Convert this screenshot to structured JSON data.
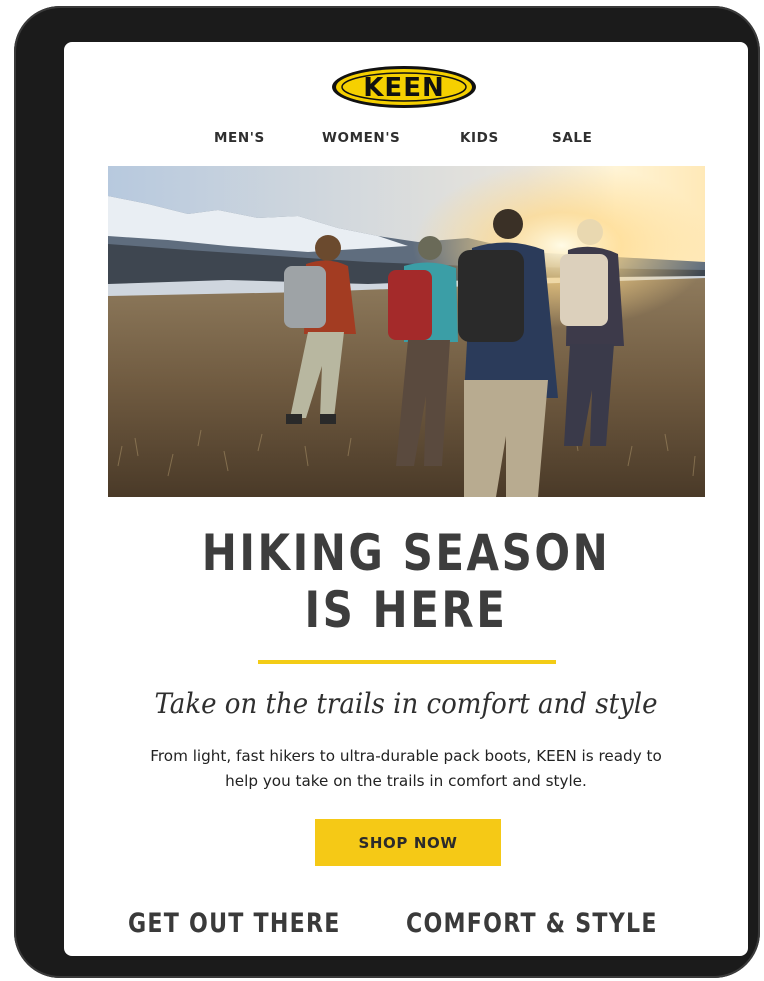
{
  "brand": {
    "logo_text": "KEEN",
    "logo_color": "#f5d000",
    "logo_outline": "#111111"
  },
  "nav": {
    "items": [
      "MEN'S",
      "WOMEN'S",
      "KIDS",
      "SALE"
    ]
  },
  "hero": {
    "image": "group-of-hikers-walking-across-meadow-at-sunset"
  },
  "headline": {
    "line1": "HIKING SEASON",
    "line2": "IS HERE"
  },
  "subhead": "Take on the trails in comfort and style",
  "body": {
    "line1": "From light, fast hikers to ultra-durable pack boots, KEEN is ready to",
    "line2": "help you take on the trails in comfort and style."
  },
  "cta": {
    "label": "SHOP NOW",
    "color": "#f5c916"
  },
  "sections": {
    "left_title": "GET OUT THERE",
    "right_title": "COMFORT & STYLE"
  },
  "colors": {
    "accent": "#f3cc16",
    "text": "#3d3d3d"
  }
}
